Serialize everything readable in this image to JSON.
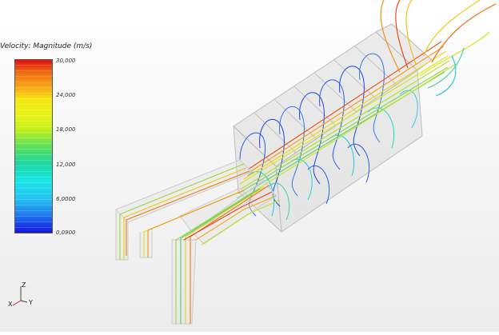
{
  "legend": {
    "title": "Velocity: Magnitude (m/s)",
    "ticks": [
      "30,000",
      "24,000",
      "18,000",
      "12,000",
      "6,0000",
      "0,0900"
    ]
  },
  "axes": {
    "z": "Z",
    "x": "X",
    "y": "Y"
  },
  "colors": {
    "scale_max": "#e01010",
    "scale_mid_high": "#f4e80e",
    "scale_mid": "#5ee05a",
    "scale_mid_low": "#18e6e6",
    "scale_min": "#1414e2",
    "housing": "#cfcfcf",
    "background": "#f2f2f2"
  }
}
